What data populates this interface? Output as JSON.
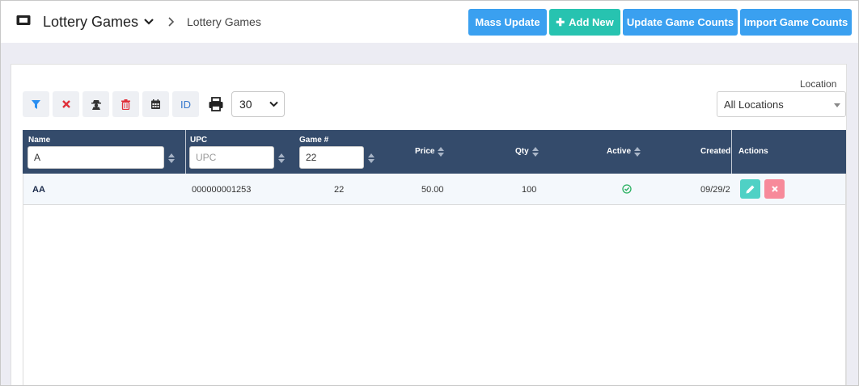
{
  "header": {
    "app_title": "Lottery Games",
    "breadcrumb": "Lottery Games",
    "buttons": {
      "mass_update": "Mass Update",
      "add_new": "Add New",
      "update_counts": "Update Game Counts",
      "import_counts": "Import Game Counts"
    }
  },
  "toolbar": {
    "id_label": "ID",
    "page_size": "30",
    "location_label": "Location",
    "location_value": "All Locations"
  },
  "table": {
    "columns": {
      "name": "Name",
      "upc": "UPC",
      "game": "Game #",
      "price": "Price",
      "qty": "Qty",
      "active": "Active",
      "created": "Created",
      "actions": "Actions"
    },
    "filters": {
      "name_value": "A",
      "upc_placeholder": "UPC",
      "game_value": "22"
    },
    "rows": [
      {
        "name": "AA",
        "upc": "000000001253",
        "game": "22",
        "price": "50.00",
        "qty": "100",
        "active": true,
        "created": "09/29/2"
      }
    ]
  },
  "colors": {
    "header_bg": "#344b6b",
    "primary": "#3aa0f0",
    "success": "#27c3b0",
    "danger": "#f78a9a"
  }
}
